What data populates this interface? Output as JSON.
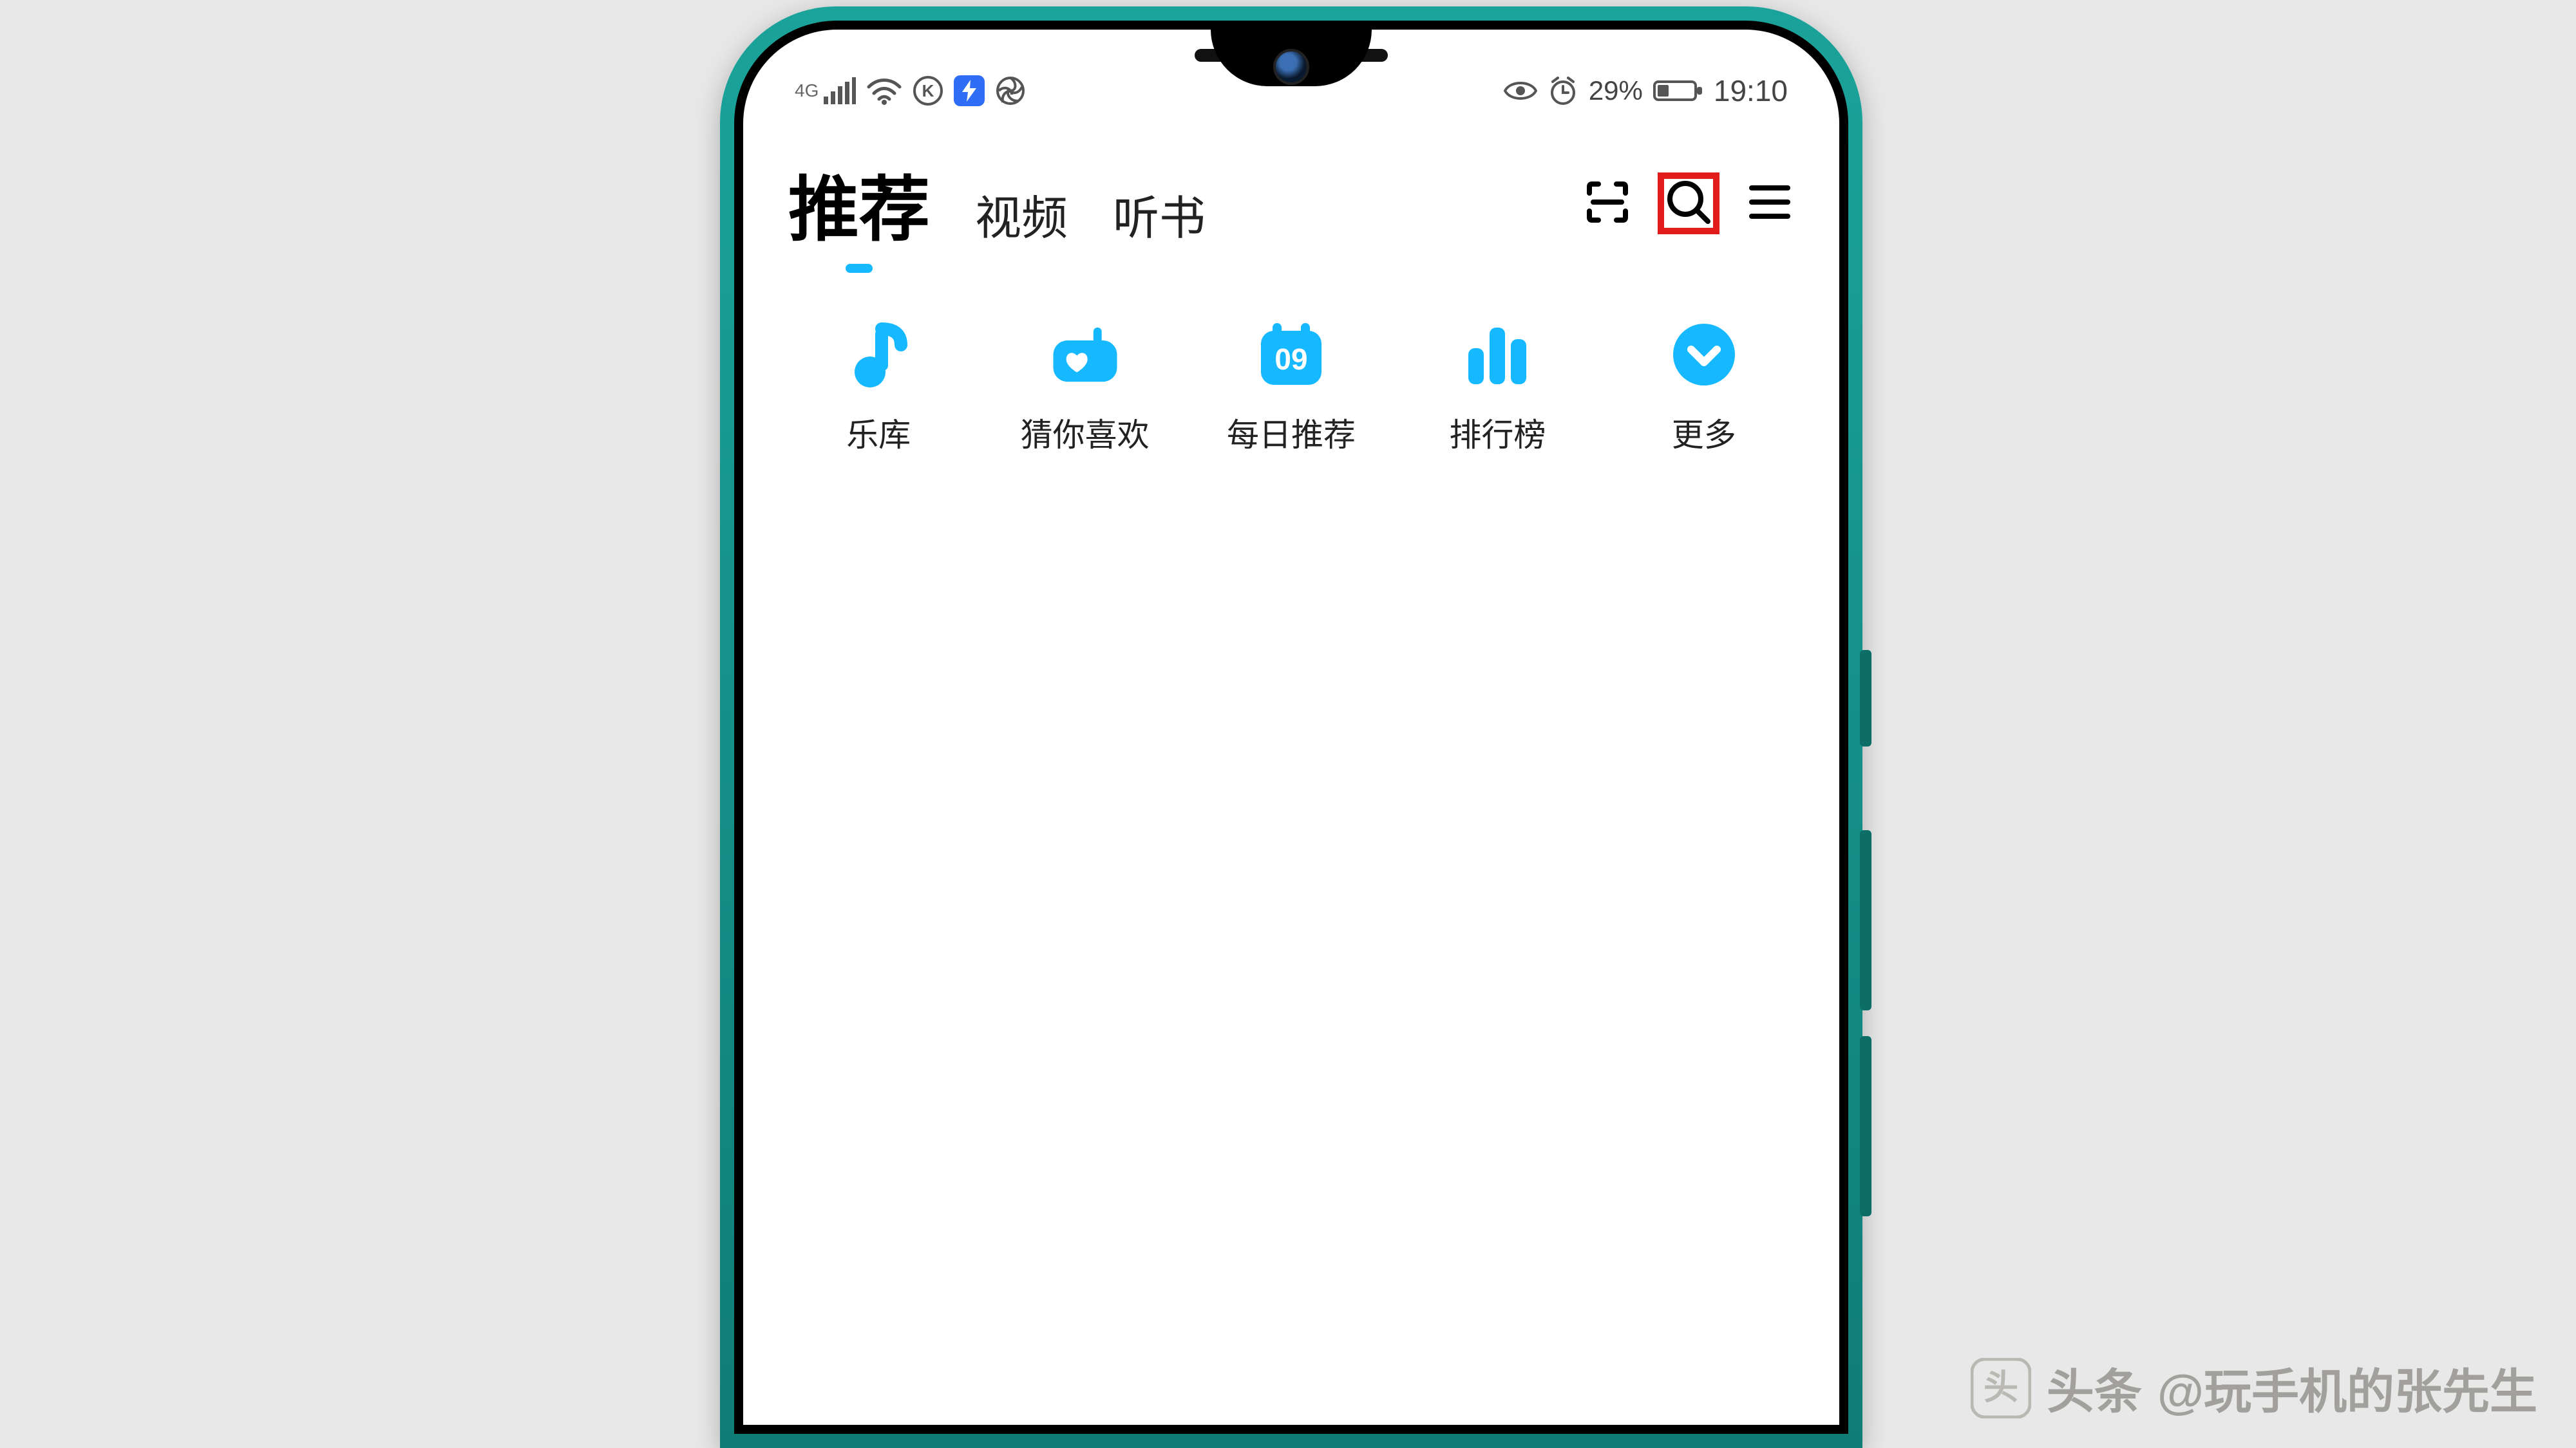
{
  "status": {
    "network_label": "4G",
    "battery_percent": "29%",
    "time": "19:10"
  },
  "header": {
    "tabs": [
      "推荐",
      "视频",
      "听书"
    ],
    "active_index": 0,
    "icons": {
      "scan": "scan-icon",
      "search": "search-icon",
      "menu": "menu-icon"
    },
    "highlighted_icon": "search"
  },
  "categories": [
    {
      "icon": "music-note-icon",
      "label": "乐库"
    },
    {
      "icon": "radio-heart-icon",
      "label": "猜你喜欢"
    },
    {
      "icon": "calendar-icon",
      "label": "每日推荐",
      "badge": "09"
    },
    {
      "icon": "bar-chart-icon",
      "label": "排行榜"
    },
    {
      "icon": "more-circle-icon",
      "label": "更多"
    }
  ],
  "colors": {
    "accent": "#16b9ff",
    "highlight_box": "#e21b1b",
    "phone_frame": "#1aa39a"
  },
  "watermark": {
    "prefix": "头条",
    "handle": "@玩手机的张先生"
  }
}
